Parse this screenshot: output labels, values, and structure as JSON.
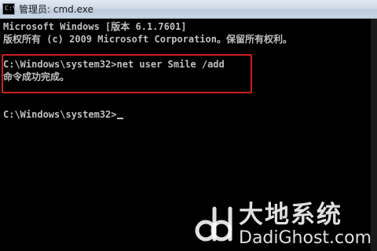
{
  "window": {
    "title": "管理员: cmd.exe",
    "icon": "cmd-icon"
  },
  "console": {
    "lines": [
      "Microsoft Windows [版本 6.1.7601]",
      "版权所有 (c) 2009 Microsoft Corporation。保留所有权利。",
      "",
      "C:\\Windows\\system32>net user Smile /add",
      "命令成功完成。",
      "",
      "",
      "C:\\Windows\\system32>"
    ],
    "text_color": "#c0c0c0",
    "background": "#000000"
  },
  "highlight": {
    "color": "#cc1f1f"
  },
  "watermark": {
    "name_cn": "大地系统",
    "name_en": "DadiGhost.com"
  }
}
